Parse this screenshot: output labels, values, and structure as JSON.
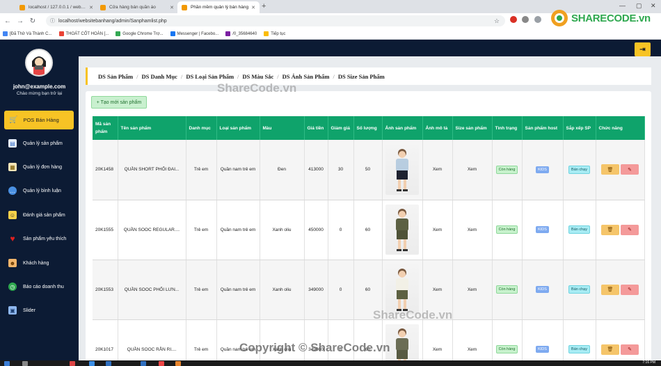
{
  "browser": {
    "tabs": [
      {
        "title": "localhost / 127.0.0.1 / web_ban",
        "active": false,
        "color": "#f29900"
      },
      {
        "title": "Cửa hàng bán quần áo",
        "active": false,
        "color": "#f29900"
      },
      {
        "title": "Phần mềm quản lý bán hàng",
        "active": true,
        "color": "#f29900"
      }
    ],
    "url": "localhost/websitebanhang/admin/Sanphamlist.php",
    "bookmarks": [
      {
        "label": "[Đã Thử Và Thành C...",
        "color": "#4285f4"
      },
      {
        "label": "THOÁT CỐT HOÀN [...",
        "color": "#e94235"
      },
      {
        "label": "Google Chrome Trợ...",
        "color": "#34a853"
      },
      {
        "label": "Messenger | Facebo...",
        "color": "#1877f2"
      },
      {
        "label": "/0_35684640",
        "color": "#7b1fa2"
      },
      {
        "label": "Tiếp tục",
        "color": "#fbbc04"
      }
    ]
  },
  "logo": {
    "text": "SHARECODE.vn"
  },
  "sidebar": {
    "email": "john@example.com",
    "welcome": "Chào mừng bạn trở lại",
    "pos_label": "POS Bán Hàng",
    "items": [
      {
        "label": "Quản lý sản phẩm",
        "icon": "product-icon",
        "color": "#e9f2ff"
      },
      {
        "label": "Quản lý đơn hàng",
        "icon": "order-icon",
        "color": "#f7e6b8"
      },
      {
        "label": "Quản lý bình luận",
        "icon": "comment-icon",
        "color": "#4a90e2"
      },
      {
        "label": "Đánh giá sản phẩm",
        "icon": "rating-icon",
        "color": "#f7d14a"
      },
      {
        "label": "Sản phẩm yêu thích",
        "icon": "heart-icon",
        "color": "#e02020"
      },
      {
        "label": "Khách hàng",
        "icon": "customer-icon",
        "color": "#f2b56b"
      },
      {
        "label": "Báo cáo doanh thu",
        "icon": "report-icon",
        "color": "#2fa84f"
      },
      {
        "label": "Slider",
        "icon": "slider-icon",
        "color": "#8fb8f0"
      }
    ]
  },
  "breadcrumb": [
    "DS Sản Phẩm",
    "DS Danh Mục",
    "DS Loại Sản Phẩm",
    "DS Màu Sắc",
    "DS Ảnh Sản Phẩm",
    "DS Size Sản Phẩm"
  ],
  "add_button": "+ Tạo mới sản phẩm",
  "table": {
    "headers": [
      "Mã sản phẩm",
      "Tên sản phẩm",
      "Danh mục",
      "Loại sản phẩm",
      "Màu",
      "Giá tiền",
      "Giảm giá",
      "Số lượng",
      "Ảnh sản phẩm",
      "Ảnh mô tả",
      "Size sản phẩm",
      "Tình trạng",
      "Sản phẩm host",
      "Sắp xếp SP",
      "Chức năng"
    ],
    "rows": [
      {
        "code": "20K1458",
        "name": "QUẦN SHORT PHỐI ĐAI...",
        "category": "Trẻ em",
        "type": "Quần nam trẻ em",
        "color": "Đen",
        "price": "413000",
        "discount": "30",
        "qty": "50",
        "desc_img": "Xem",
        "size": "Xem",
        "status": "Còn hàng",
        "host": "KIDS",
        "sort": "Bán chạy",
        "shirt": "#b8cde0",
        "pants": "#1e2230"
      },
      {
        "code": "20K1555",
        "name": "QUẦN SOOC REGULAR....",
        "category": "Trẻ em",
        "type": "Quần nam trẻ em",
        "color": "Xanh oliu",
        "price": "450000",
        "discount": "0",
        "qty": "60",
        "desc_img": "Xem",
        "size": "Xem",
        "status": "Còn hàng",
        "host": "KIDS",
        "sort": "Bán chạy",
        "shirt": "#5c6043",
        "pants": "#4f5338"
      },
      {
        "code": "20K1553",
        "name": "QUẦN SOOC PHỐI LƯN...",
        "category": "Trẻ em",
        "type": "Quần nam trẻ em",
        "color": "Xanh oliu",
        "price": "349000",
        "discount": "0",
        "qty": "60",
        "desc_img": "Xem",
        "size": "Xem",
        "status": "Còn hàng",
        "host": "KIDS",
        "sort": "Bán chạy",
        "shirt": "#f2f0e6",
        "pants": "#5d6142"
      },
      {
        "code": "20K1017",
        "name": "QUẦN SOOC RẰN RI....",
        "category": "Trẻ em",
        "type": "Quần nam trẻ em",
        "color": "Xanh oliu",
        "price": "349000",
        "discount": "0",
        "qty": "60",
        "desc_img": "Xem",
        "size": "Xem",
        "status": "Còn hàng",
        "host": "KIDS",
        "sort": "Bán chạy",
        "shirt": "#6b6d55",
        "pants": "#585b43"
      }
    ]
  },
  "watermarks": {
    "top": "ShareCode.vn",
    "middle": "ShareCode.vn",
    "bottom": "Copyright © ShareCode.vn"
  },
  "clock": "7:16 PM"
}
